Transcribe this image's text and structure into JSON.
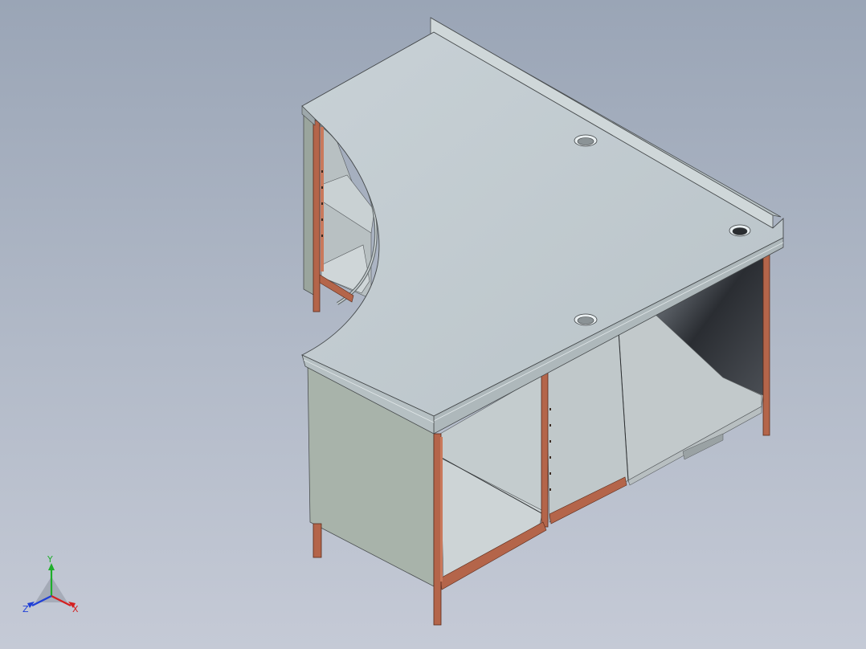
{
  "viewport": {
    "background_top": "#9aa5b6",
    "background_bottom": "#c5cad6"
  },
  "model": {
    "frame_color": "#b4654a",
    "panel_color": "#a7b3a9",
    "top_color": "#bfc9ce"
  },
  "triad": {
    "x_label": "X",
    "y_label": "Y",
    "z_label": "Z",
    "x_color": "#d42020",
    "y_color": "#1fae2b",
    "z_color": "#1f3fd6"
  }
}
